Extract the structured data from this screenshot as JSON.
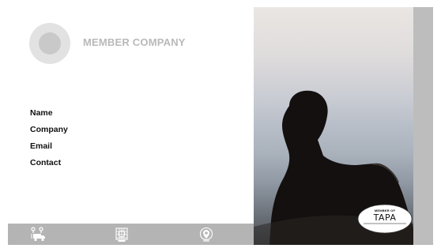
{
  "card": {
    "company_title": "MEMBER COMPANY",
    "fields": [
      "Name",
      "Company",
      "Email",
      "Contact"
    ]
  },
  "bottom_bar": {
    "icons": [
      "delivery-truck-icon",
      "globe-grid-icon",
      "location-pin-icon"
    ]
  },
  "badge": {
    "caption": "MEMBER OF",
    "logo_text": "TAPA"
  },
  "colors": {
    "bar": "#b4b4b4",
    "title": "#b9b9b9",
    "strip": "#bdbdbd"
  }
}
